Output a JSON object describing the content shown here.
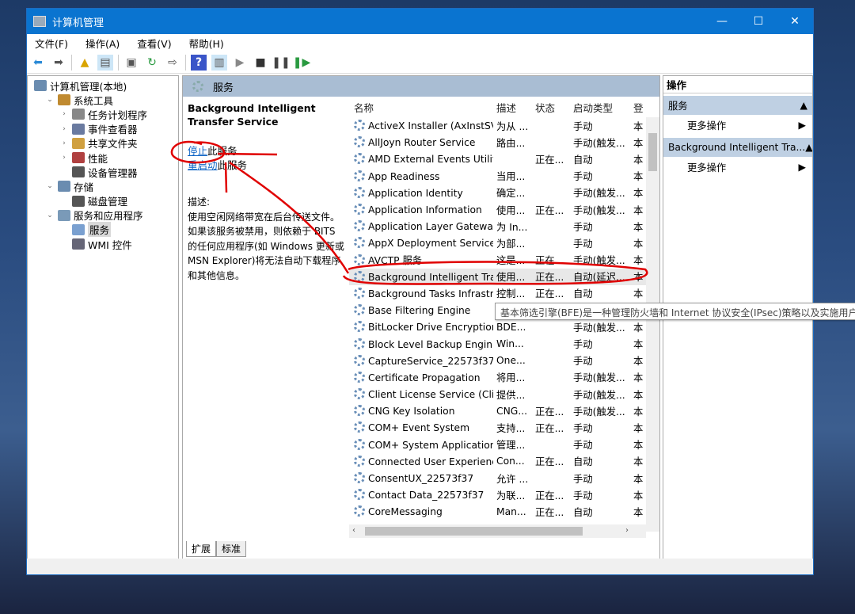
{
  "window": {
    "title": "计算机管理",
    "controls": [
      "—",
      "☐",
      "✕"
    ]
  },
  "menu": [
    "文件(F)",
    "操作(A)",
    "查看(V)",
    "帮助(H)"
  ],
  "toolbar": [
    "back-icon",
    "forward-icon",
    "up-icon",
    "show-tree-icon",
    "properties-icon",
    "refresh-icon",
    "export-icon",
    "help-icon",
    "console-icon",
    "start-icon",
    "stop-icon",
    "pause-icon",
    "resume-icon"
  ],
  "tree": [
    {
      "label": "计算机管理(本地)",
      "level": 0,
      "arrow": ""
    },
    {
      "label": "系统工具",
      "level": 1,
      "arrow": "⌄"
    },
    {
      "label": "任务计划程序",
      "level": 2,
      "arrow": "›"
    },
    {
      "label": "事件查看器",
      "level": 2,
      "arrow": "›"
    },
    {
      "label": "共享文件夹",
      "level": 2,
      "arrow": "›"
    },
    {
      "label": "性能",
      "level": 2,
      "arrow": "›"
    },
    {
      "label": "设备管理器",
      "level": 2,
      "arrow": ""
    },
    {
      "label": "存储",
      "level": 1,
      "arrow": "⌄"
    },
    {
      "label": "磁盘管理",
      "level": 2,
      "arrow": ""
    },
    {
      "label": "服务和应用程序",
      "level": 1,
      "arrow": "⌄"
    },
    {
      "label": "服务",
      "level": 2,
      "arrow": "",
      "selected": true
    },
    {
      "label": "WMI 控件",
      "level": 2,
      "arrow": ""
    }
  ],
  "middle": {
    "header": "服务",
    "detail": {
      "title": "Background Intelligent Transfer Service",
      "stop_link": "停止",
      "stop_suffix": "此服务",
      "restart_link": "重启动",
      "restart_suffix": "此服务",
      "desc_label": "描述:",
      "desc": "使用空闲网络带宽在后台传送文件。如果该服务被禁用，则依赖于 BITS 的任何应用程序(如 Windows 更新或 MSN Explorer)将无法自动下载程序和其他信息。"
    },
    "columns": [
      "名称",
      "描述",
      "状态",
      "启动类型",
      "登"
    ],
    "rows": [
      [
        "ActiveX Installer (AxInstSV)",
        "为从 ...",
        "",
        "手动",
        "本"
      ],
      [
        "AllJoyn Router Service",
        "路由...",
        "",
        "手动(触发...",
        "本"
      ],
      [
        "AMD External Events Utility",
        "",
        "正在...",
        "自动",
        "本"
      ],
      [
        "App Readiness",
        "当用...",
        "",
        "手动",
        "本"
      ],
      [
        "Application Identity",
        "确定...",
        "",
        "手动(触发...",
        "本"
      ],
      [
        "Application Information",
        "使用...",
        "正在...",
        "手动(触发...",
        "本"
      ],
      [
        "Application Layer Gateway ...",
        "为 In...",
        "",
        "手动",
        "本"
      ],
      [
        "AppX Deployment Service ...",
        "为部...",
        "",
        "手动",
        "本"
      ],
      [
        "AVCTP 服务",
        "这是...",
        "正在...",
        "手动(触发...",
        "本"
      ],
      [
        "Background Intelligent Tra...",
        "使用...",
        "正在...",
        "自动(延迟...",
        "本"
      ],
      [
        "Background Tasks Infrastru...",
        "控制...",
        "正在...",
        "自动",
        "本"
      ],
      [
        "Base Filtering Engine",
        "",
        "",
        "",
        "本"
      ],
      [
        "BitLocker Drive Encryption ...",
        "BDE...",
        "",
        "手动(触发...",
        "本"
      ],
      [
        "Block Level Backup Engine ...",
        "Win...",
        "",
        "手动",
        "本"
      ],
      [
        "CaptureService_22573f37",
        "One...",
        "",
        "手动",
        "本"
      ],
      [
        "Certificate Propagation",
        "将用...",
        "",
        "手动(触发...",
        "本"
      ],
      [
        "Client License Service (Clip...",
        "提供...",
        "",
        "手动(触发...",
        "本"
      ],
      [
        "CNG Key Isolation",
        "CNG...",
        "正在...",
        "手动(触发...",
        "本"
      ],
      [
        "COM+ Event System",
        "支持...",
        "正在...",
        "手动",
        "本"
      ],
      [
        "COM+ System Application",
        "管理...",
        "",
        "手动",
        "本"
      ],
      [
        "Connected User Experienc...",
        "Con...",
        "正在...",
        "自动",
        "本"
      ],
      [
        "ConsentUX_22573f37",
        "允许 ...",
        "",
        "手动",
        "本"
      ],
      [
        "Contact Data_22573f37",
        "为联...",
        "正在...",
        "手动",
        "本"
      ],
      [
        "CoreMessaging",
        "Man...",
        "正在...",
        "自动",
        "本"
      ]
    ],
    "selected_row": 9,
    "tooltip": "基本筛选引擎(BFE)是一种管理防火墙和 Internet 协议安全(IPsec)策略以及实施用户模",
    "tabs": [
      "扩展",
      "标准"
    ]
  },
  "actions": {
    "header": "操作",
    "sections": [
      {
        "title": "服务",
        "item": "更多操作"
      },
      {
        "title": "Background Intelligent Tra...",
        "item": "更多操作"
      }
    ]
  },
  "colors": {
    "titlebar": "#0a74d0",
    "panel_header": "#a9bdd3",
    "action_section": "#bfd0e3",
    "annotation": "#e00000",
    "link": "#0b62c4"
  }
}
